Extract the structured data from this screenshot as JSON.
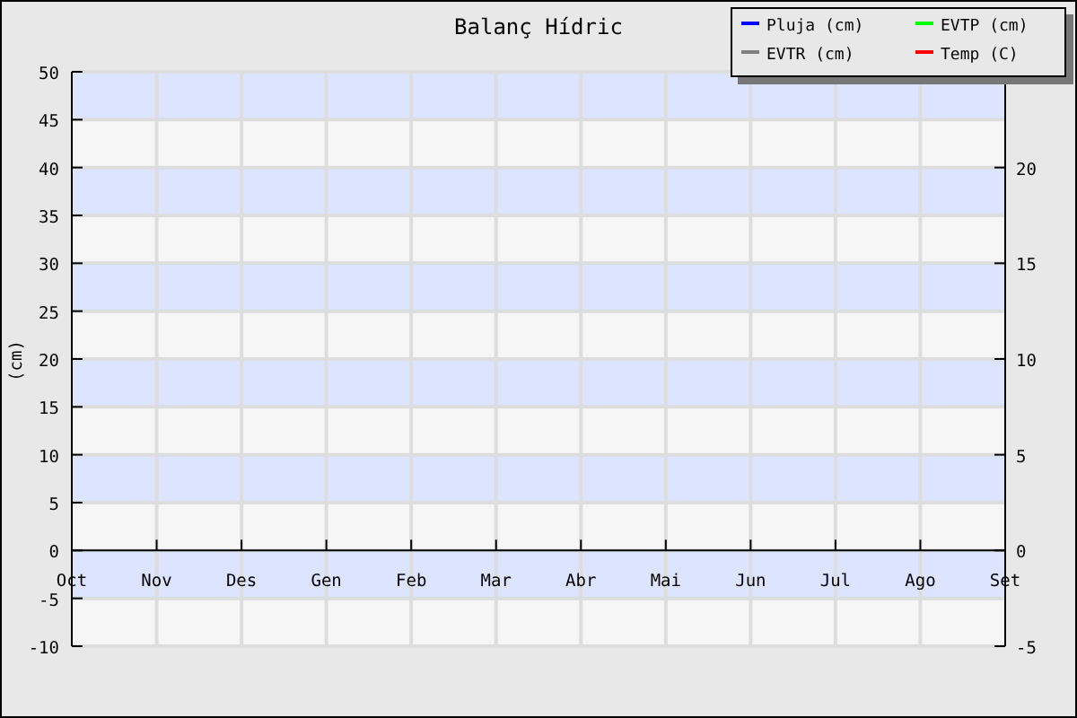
{
  "chart_data": {
    "type": "line",
    "grid": true,
    "title": "Balanç Hídric",
    "ylabel": "(cm)",
    "categories": [
      "Oct",
      "Nov",
      "Des",
      "Gen",
      "Feb",
      "Mar",
      "Abr",
      "Mai",
      "Jun",
      "Jul",
      "Ago",
      "Set"
    ],
    "ylim": [
      -10,
      50
    ],
    "yticks": [
      -10,
      -5,
      0,
      5,
      10,
      15,
      20,
      25,
      30,
      35,
      40,
      45,
      50
    ],
    "y2lim": [
      -5,
      25
    ],
    "y2ticks": [
      -5,
      0,
      5,
      10,
      15,
      20
    ],
    "series": [
      {
        "name": "Pluja (cm)",
        "color": "#0000ff",
        "values": [
          null,
          null,
          null,
          null,
          null,
          null,
          null,
          null,
          null,
          null,
          null,
          null
        ]
      },
      {
        "name": "EVTP (cm)",
        "color": "#00ff00",
        "values": [
          null,
          null,
          null,
          null,
          null,
          null,
          null,
          null,
          null,
          null,
          null,
          null
        ]
      },
      {
        "name": "EVTR (cm)",
        "color": "#808080",
        "values": [
          null,
          null,
          null,
          null,
          null,
          null,
          null,
          null,
          null,
          null,
          null,
          null
        ]
      },
      {
        "name": "Temp (C)",
        "color": "#ff0000",
        "values": [
          null,
          null,
          null,
          null,
          null,
          null,
          null,
          null,
          null,
          null,
          null,
          null
        ]
      }
    ]
  }
}
